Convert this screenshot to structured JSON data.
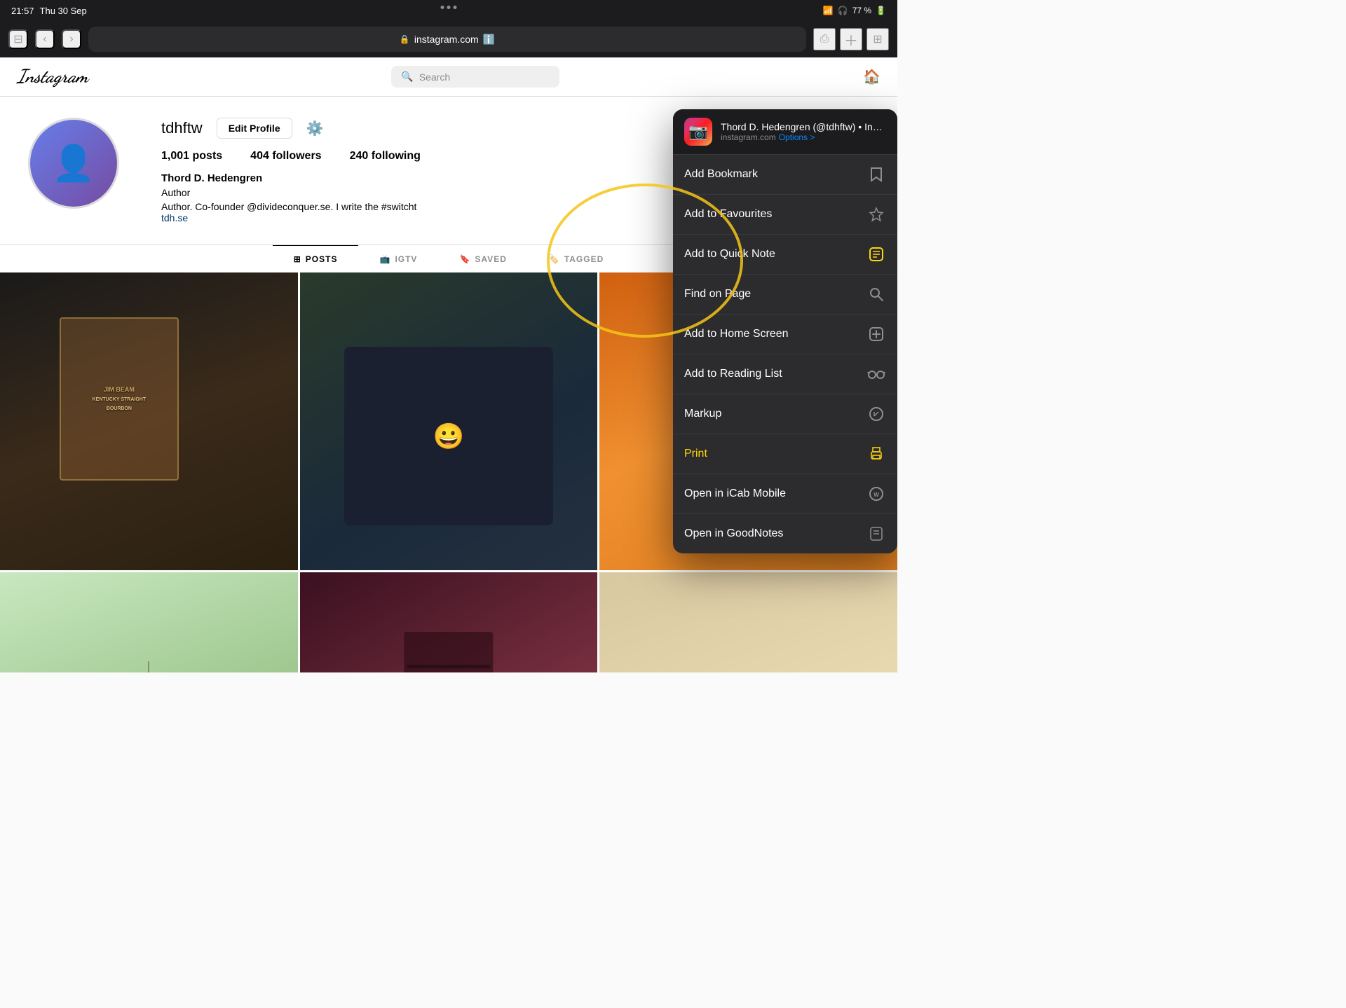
{
  "statusBar": {
    "time": "21:57",
    "date": "Thu 30 Sep",
    "wifi_icon": "wifi",
    "headphones_icon": "headphones",
    "battery_percent": "77 %"
  },
  "browser": {
    "url": "instagram.com",
    "lock_icon": "lock",
    "sidebar_icon": "sidebar",
    "back_icon": "chevron-left",
    "forward_icon": "chevron-right",
    "refresh_icon": "refresh",
    "share_icon": "share",
    "new_tab_icon": "plus",
    "tabs_icon": "tabs"
  },
  "instagram": {
    "logo": "Instagram",
    "search_placeholder": "Search",
    "home_icon": "home",
    "username": "tdhftw",
    "edit_profile_label": "Edit Profile",
    "settings_icon": "settings",
    "stats": {
      "posts": "1,001",
      "posts_label": "posts",
      "followers": "404",
      "followers_label": "followers",
      "following": "240",
      "following_label": "following"
    },
    "display_name": "Thord D. Hedengren",
    "title": "Author",
    "bio": "Author. Co-founder @divideconquer.se. I write the #switcht",
    "bio_link": "tdh.se",
    "tabs": [
      "POSTS",
      "IGTV",
      "SAVED",
      "TAGGED"
    ],
    "active_tab": "POSTS"
  },
  "sharePanel": {
    "app_icon": "📷",
    "title": "Thord D. Hedengren (@tdhftw) • Instag...",
    "subtitle": "instagram.com",
    "options_label": "Options >",
    "menuItems": [
      {
        "label": "Add Bookmark",
        "icon": "bookmark",
        "id": "add-bookmark"
      },
      {
        "label": "Add to Favourites",
        "icon": "star",
        "id": "add-favourites"
      },
      {
        "label": "Add to Quick Note",
        "icon": "quick-note",
        "id": "add-quick-note"
      },
      {
        "label": "Find on Page",
        "icon": "search",
        "id": "find-on-page"
      },
      {
        "label": "Add to Home Screen",
        "icon": "plus-square",
        "id": "add-home-screen"
      },
      {
        "label": "Add to Reading List",
        "icon": "glasses",
        "id": "add-reading-list"
      },
      {
        "label": "Markup",
        "icon": "pencil-circle",
        "id": "markup"
      },
      {
        "label": "Print",
        "icon": "printer",
        "id": "print",
        "highlight": true
      },
      {
        "label": "Open in iCab Mobile",
        "icon": "icab",
        "id": "open-icab"
      },
      {
        "label": "Open in GoodNotes",
        "icon": "goodnotes",
        "id": "open-goodnotes"
      }
    ]
  }
}
